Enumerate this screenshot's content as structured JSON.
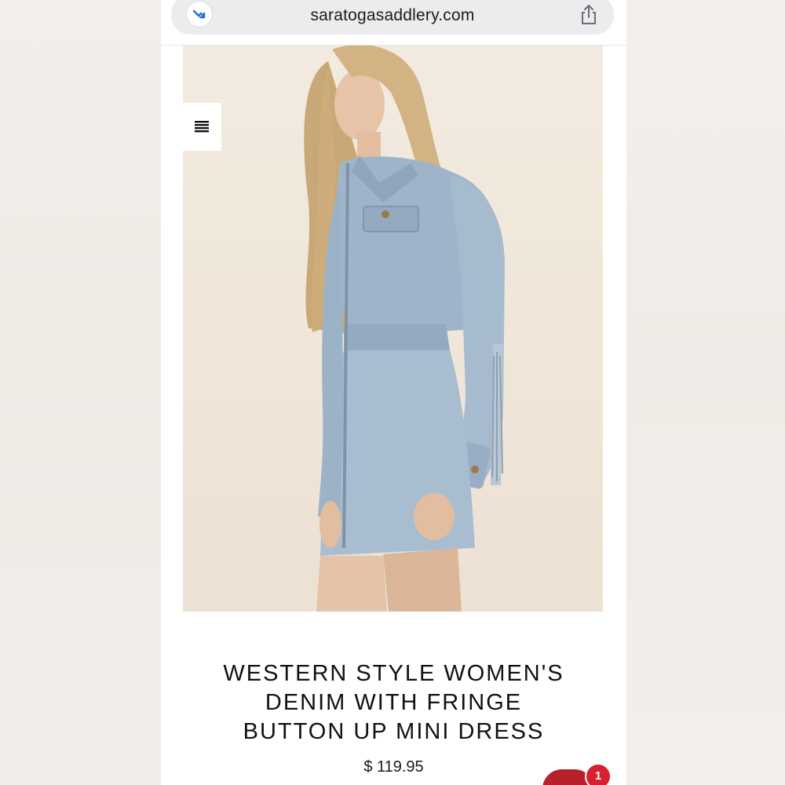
{
  "browser": {
    "url": "saratogasaddlery.com",
    "left_icon": "reader-arrow-icon",
    "right_icon": "share-icon"
  },
  "header": {
    "menu_icon": "hamburger-menu-icon"
  },
  "product": {
    "image_alt": "Model wearing light-wash denim button up mini dress with fringe sleeves",
    "title_lines": [
      "WESTERN STYLE WOMEN'S",
      "DENIM WITH FRINGE",
      "BUTTON UP MINI DRESS"
    ],
    "price": "$ 119.95"
  },
  "chat": {
    "badge_count": "1"
  },
  "colors": {
    "badge": "#d8202e",
    "chat": "#b8212c",
    "url_bar": "#ececee"
  }
}
